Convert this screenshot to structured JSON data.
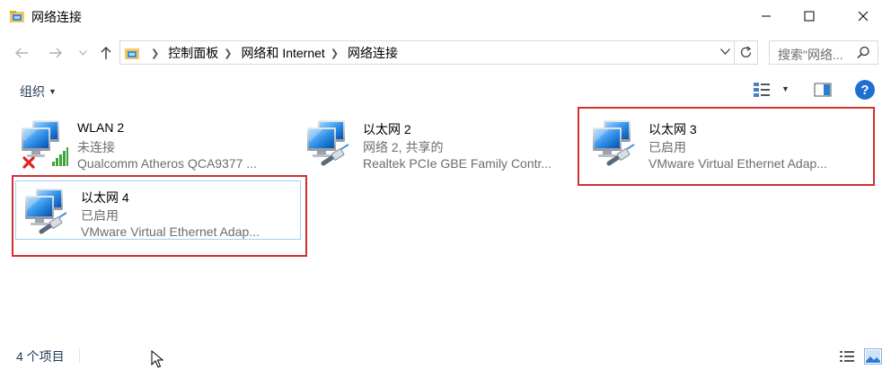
{
  "window": {
    "title": "网络连接"
  },
  "breadcrumb": {
    "items": [
      "控制面板",
      "网络和 Internet",
      "网络连接"
    ]
  },
  "search": {
    "placeholder": "搜索\"网络..."
  },
  "toolbar": {
    "organize_label": "组织"
  },
  "connections": [
    {
      "name": "WLAN 2",
      "status": "未连接",
      "device": "Qualcomm Atheros QCA9377 ...",
      "icon": "wifi-disconnected-icon"
    },
    {
      "name": "以太网 2",
      "status": "网络  2, 共享的",
      "device": "Realtek PCIe GBE Family Contr...",
      "icon": "ethernet-icon"
    },
    {
      "name": "以太网 3",
      "status": "已启用",
      "device": "VMware Virtual Ethernet Adap...",
      "icon": "ethernet-icon"
    },
    {
      "name": "以太网 4",
      "status": "已启用",
      "device": "VMware Virtual Ethernet Adap...",
      "icon": "ethernet-icon"
    }
  ],
  "statusbar": {
    "count": "4 个项目"
  },
  "colors": {
    "accent": "#1f6fd1",
    "highlight_box": "#d32f2f",
    "selection_border": "#99d1ff"
  }
}
